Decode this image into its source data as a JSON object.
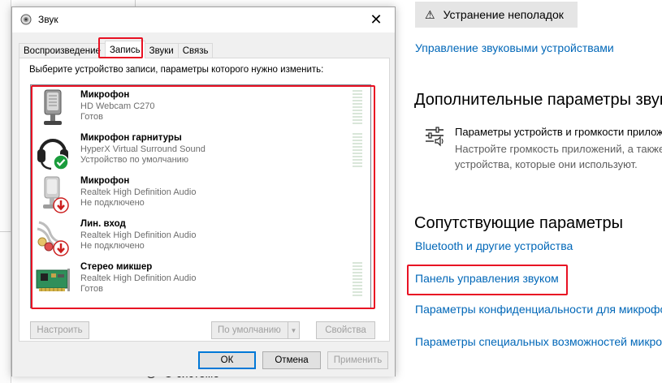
{
  "settings": {
    "troubleshoot_label": "Устранение неполадок",
    "manage_devices_link": "Управление звуковыми устройствами",
    "advanced_heading": "Дополнительные параметры звука",
    "app_volume_title": "Параметры устройств и громкости приложений",
    "app_volume_desc_1": "Настройте громкость приложений, а также",
    "app_volume_desc_2": "устройства, которые они используют.",
    "related_heading": "Сопутствующие параметры",
    "bluetooth_link": "Bluetooth и другие устройства",
    "sound_panel_link": "Панель управления звуком",
    "mic_privacy_link": "Параметры конфиденциальности для микрофона",
    "accessibility_link": "Параметры специальных возможностей микрофона",
    "about_label": "О системе"
  },
  "dialog": {
    "title": "Звук",
    "tabs": [
      {
        "label": "Воспроизведение",
        "active": false
      },
      {
        "label": "Запись",
        "active": true
      },
      {
        "label": "Звуки",
        "active": false
      },
      {
        "label": "Связь",
        "active": false
      }
    ],
    "instruction": "Выберите устройство записи, параметры которого нужно изменить:",
    "devices": [
      {
        "name": "Микрофон",
        "description": "HD Webcam C270",
        "status": "Готов",
        "icon": "webcam-mic-icon"
      },
      {
        "name": "Микрофон гарнитуры",
        "description": "HyperX Virtual Surround Sound",
        "status": "Устройство по умолчанию",
        "icon": "headset-icon",
        "badge": "default-check-icon"
      },
      {
        "name": "Микрофон",
        "description": "Realtek High Definition Audio",
        "status": "Не подключено",
        "icon": "microphone-icon",
        "badge": "disconnected-arrow-icon"
      },
      {
        "name": "Лин. вход",
        "description": "Realtek High Definition Audio",
        "status": "Не подключено",
        "icon": "line-in-icon",
        "badge": "disconnected-arrow-icon"
      },
      {
        "name": "Стерео микшер",
        "description": "Realtek High Definition Audio",
        "status": "Готов",
        "icon": "sound-card-icon"
      }
    ],
    "buttons": {
      "configure": "Настроить",
      "set_default": "По умолчанию",
      "properties": "Свойства",
      "ok": "ОК",
      "cancel": "Отмена",
      "apply": "Применить"
    }
  },
  "colors": {
    "link": "#0067b8",
    "highlight_red": "#e81123",
    "default_button_border": "#0078d7"
  }
}
